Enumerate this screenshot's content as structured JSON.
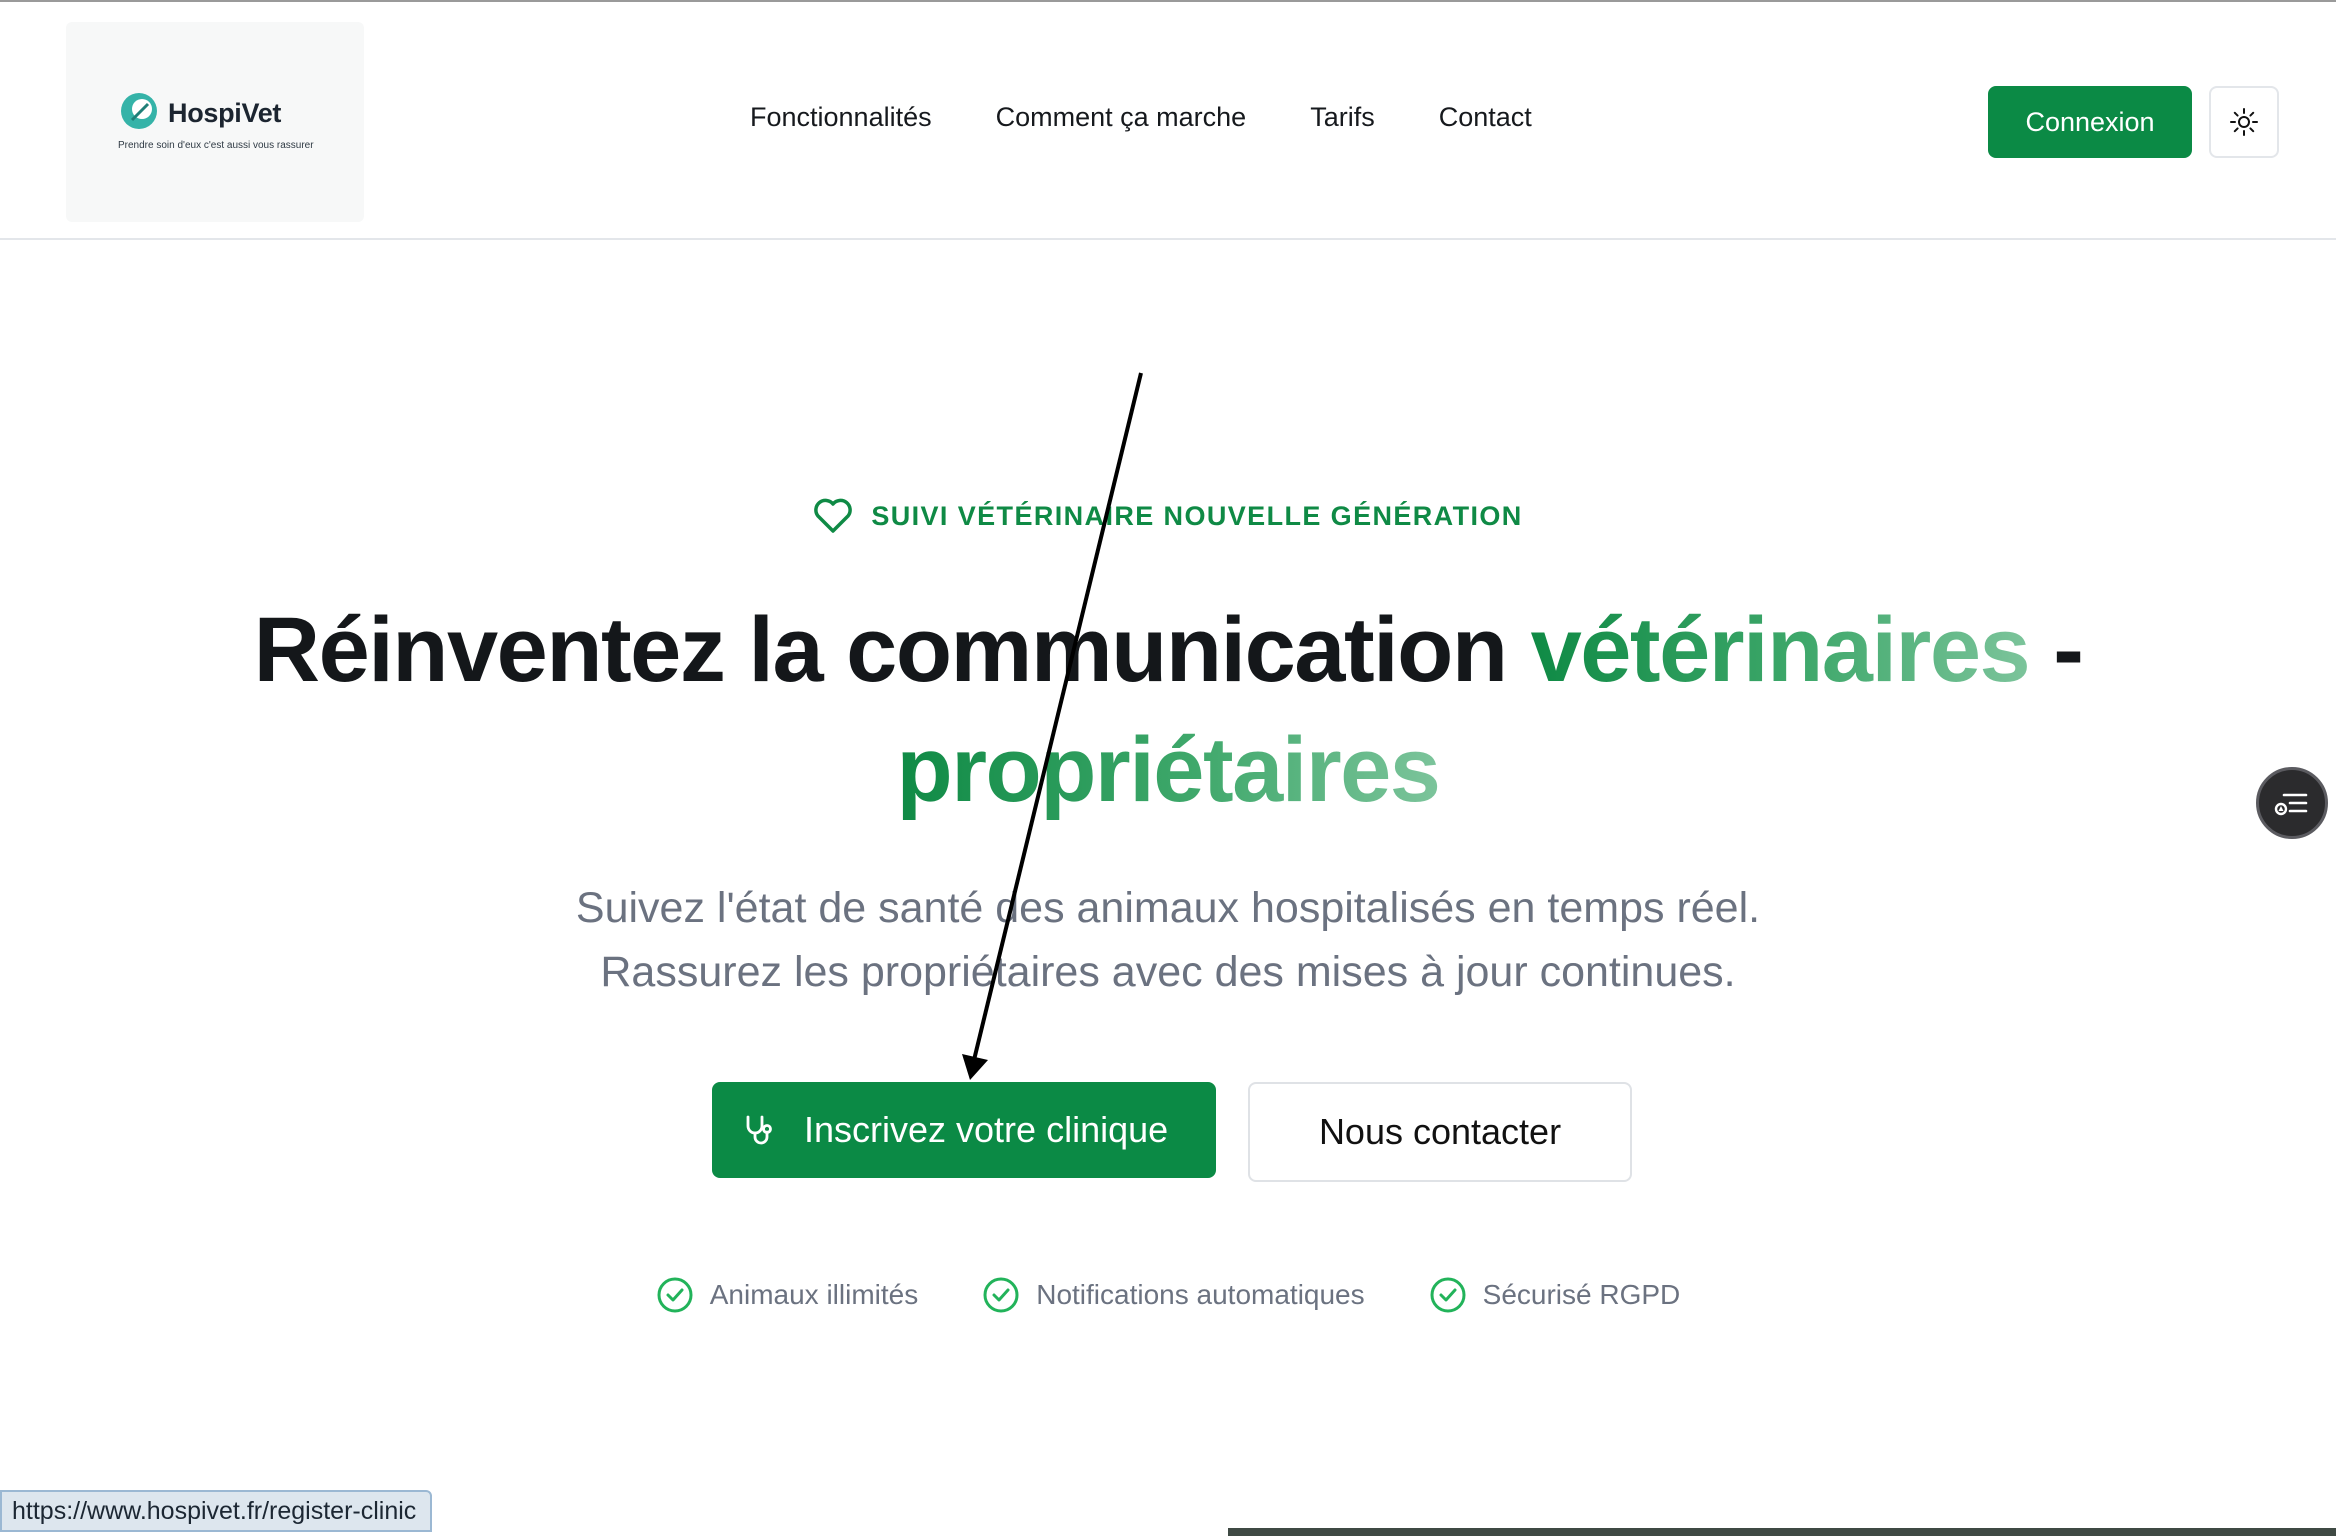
{
  "header": {
    "logo": {
      "name": "HospiVet",
      "tagline": "Prendre soin d'eux c'est aussi vous rassurer"
    },
    "nav": [
      {
        "label": "Fonctionnalités"
      },
      {
        "label": "Comment ça marche"
      },
      {
        "label": "Tarifs"
      },
      {
        "label": "Contact"
      }
    ],
    "login_label": "Connexion"
  },
  "hero": {
    "eyebrow": "SUIVI VÉTÉRINAIRE NOUVELLE GÉNÉRATION",
    "headline_part1": "Réinventez la communication ",
    "headline_highlight1": "vétérinaires",
    "headline_sep": " -",
    "headline_highlight2": "propriétaires",
    "subtitle_line1": "Suivez l'état de santé des animaux hospitalisés en temps réel.",
    "subtitle_line2": "Rassurez les propriétaires avec des mises à jour continues.",
    "cta_primary": "Inscrivez votre clinique",
    "cta_secondary": "Nous contacter",
    "features": [
      {
        "label": "Animaux illimités"
      },
      {
        "label": "Notifications automatiques"
      },
      {
        "label": "Sécurisé RGPD"
      }
    ]
  },
  "status_bar": {
    "url": "https://www.hospivet.fr/register-clinic"
  },
  "colors": {
    "brand_green": "#0b8a45",
    "text_dark": "#14171a",
    "text_muted": "#6b7280"
  },
  "icons": [
    "heart-icon",
    "stethoscope-icon",
    "check-circle-icon",
    "sun-icon",
    "list-icon"
  ]
}
